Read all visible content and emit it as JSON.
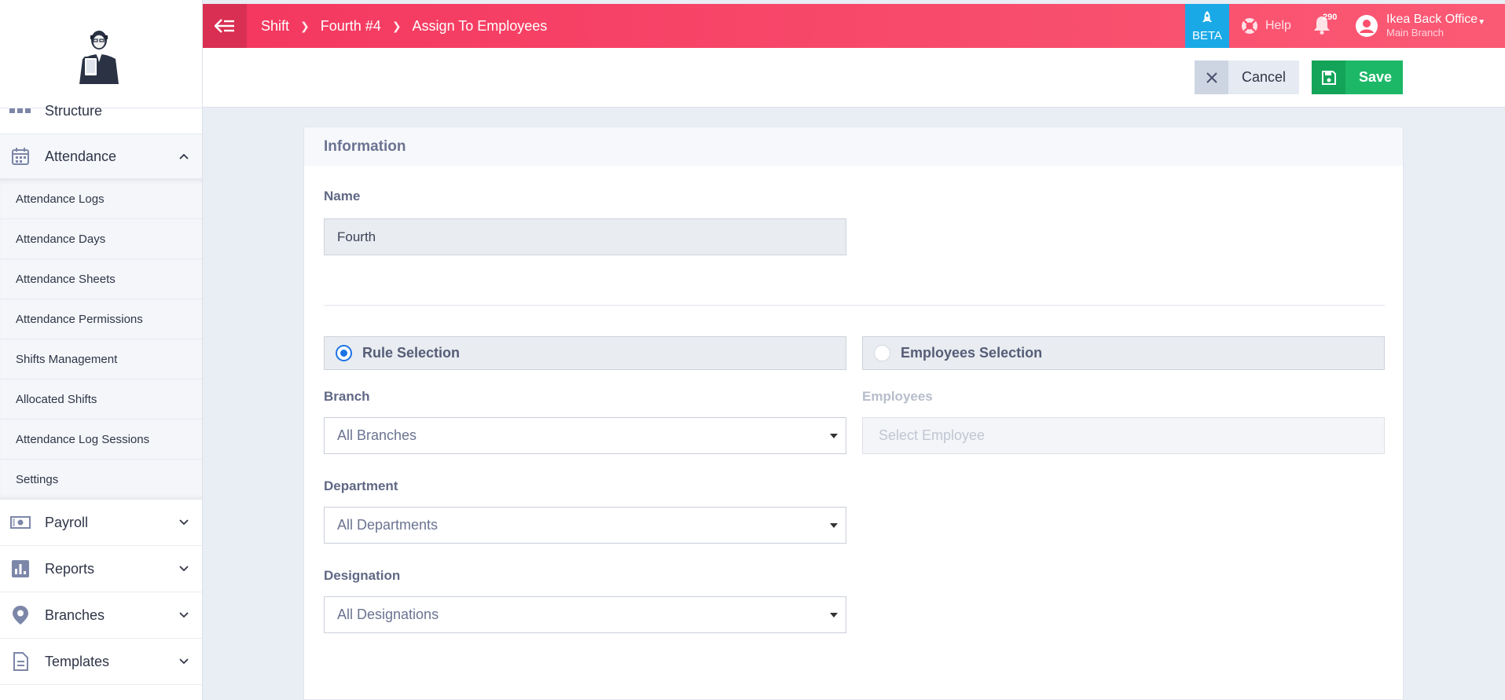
{
  "sidebar": {
    "items": {
      "structure": "Structure",
      "attendance": "Attendance",
      "payroll": "Payroll",
      "reports": "Reports",
      "branches": "Branches",
      "templates": "Templates"
    },
    "attendance_submenu": [
      "Attendance Logs",
      "Attendance Days",
      "Attendance Sheets",
      "Attendance Permissions",
      "Shifts Management",
      "Allocated Shifts",
      "Attendance Log Sessions",
      "Settings"
    ]
  },
  "topbar": {
    "breadcrumb": [
      "Shift",
      "Fourth #4",
      "Assign To Employees"
    ],
    "beta_label": "BETA",
    "help_label": "Help",
    "notifications_count": "290",
    "user_name": "Ikea Back Office",
    "user_branch": "Main Branch"
  },
  "actions": {
    "cancel_label": "Cancel",
    "save_label": "Save"
  },
  "form": {
    "section_title": "Information",
    "name_label": "Name",
    "name_value": "Fourth",
    "rule_selection_label": "Rule Selection",
    "employees_selection_label": "Employees Selection",
    "selected_mode": "Rule Selection",
    "branch_label": "Branch",
    "branch_value": "All Branches",
    "employees_label": "Employees",
    "employees_placeholder": "Select Employee",
    "department_label": "Department",
    "department_value": "All Departments",
    "designation_label": "Designation",
    "designation_value": "All Designations"
  },
  "colors": {
    "topbar": "#f4375f",
    "beta": "#19a9e6",
    "save": "#1cb868",
    "radio_on": "#1a73e8"
  }
}
